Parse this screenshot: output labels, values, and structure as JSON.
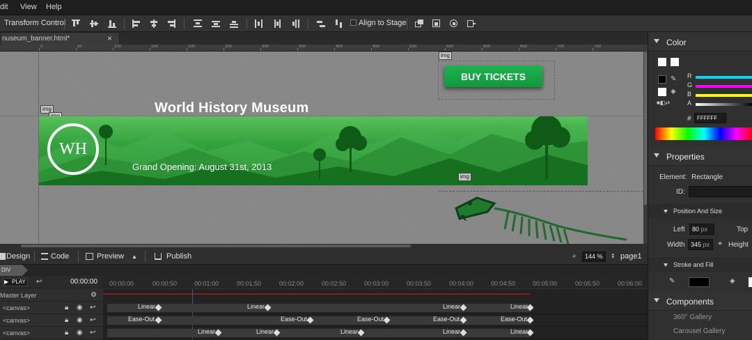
{
  "menubar": {
    "items": [
      "dit",
      "View",
      "Help"
    ]
  },
  "toolbar": {
    "transform_control": "Transform Control",
    "align_to_stage": "Align to Stage"
  },
  "document": {
    "tab_name": "nuseum_banner.html*",
    "close": "×"
  },
  "ruler": {
    "labels": [
      "0",
      "50",
      "100",
      "150",
      "200",
      "250",
      "300",
      "350",
      "400",
      "450",
      "500",
      "550",
      "600",
      "650",
      "700",
      "750"
    ]
  },
  "stage": {
    "title": "World History Museum",
    "banner": {
      "logo_text": "WH",
      "subtitle": "Grand Opening: August 31st, 2013"
    },
    "button_label": "BUY TICKETS",
    "img_tags": [
      "img",
      "img",
      "img",
      "img"
    ],
    "colors": {
      "banner_green": "#2ea23b",
      "button_green": "#17a845",
      "stage_gray": "#8a8a8a"
    }
  },
  "viewbar": {
    "design": "Design",
    "code": "Code",
    "preview": "Preview",
    "publish": "Publish",
    "zoom": "144 %",
    "page": "page1"
  },
  "timeline": {
    "tab": "DIV",
    "play": "PLAY",
    "time": "00:00:00",
    "ticks": [
      "00:00:00",
      "00:00:50",
      "00:01:00",
      "00:01:50",
      "00:02:00",
      "00:02:50",
      "00:03:00",
      "00:03:50",
      "00:04:00",
      "00:04:50",
      "00:05:00",
      "00:05:50",
      "00:06:00"
    ],
    "layers": [
      {
        "name": "Master Layer"
      },
      {
        "name": "<canvas>"
      },
      {
        "name": "<canvas>"
      },
      {
        "name": "<canvas>"
      }
    ],
    "tracks": [
      {
        "labels": [
          "Linear",
          "Linear",
          "Linear",
          "Linear"
        ]
      },
      {
        "labels": [
          "Ease-Out",
          "Ease-Out",
          "Ease-Out",
          "Ease-Out",
          "Ease-Out"
        ]
      },
      {
        "labels": [
          "Linear",
          "Linear",
          "Linear",
          "Linear",
          "Linear"
        ]
      }
    ]
  },
  "color_panel": {
    "title": "Color",
    "channels": [
      "R",
      "G",
      "B",
      "A"
    ],
    "hex_label": "#",
    "hex_value": "FFFFFF"
  },
  "properties_panel": {
    "title": "Properties",
    "element_label": "Element:",
    "element_value": "Rectangle",
    "id_label": "ID:",
    "position_title": "Position And Size",
    "left_label": "Left",
    "left_value": "80",
    "left_unit": "px",
    "top_label": "Top",
    "width_label": "Width",
    "width_value": "345",
    "width_unit": "px",
    "height_label": "Height",
    "stroke_title": "Stroke and Fill"
  },
  "components_panel": {
    "title": "Components",
    "items": [
      "360° Gallery",
      "Carousel Gallery"
    ]
  }
}
